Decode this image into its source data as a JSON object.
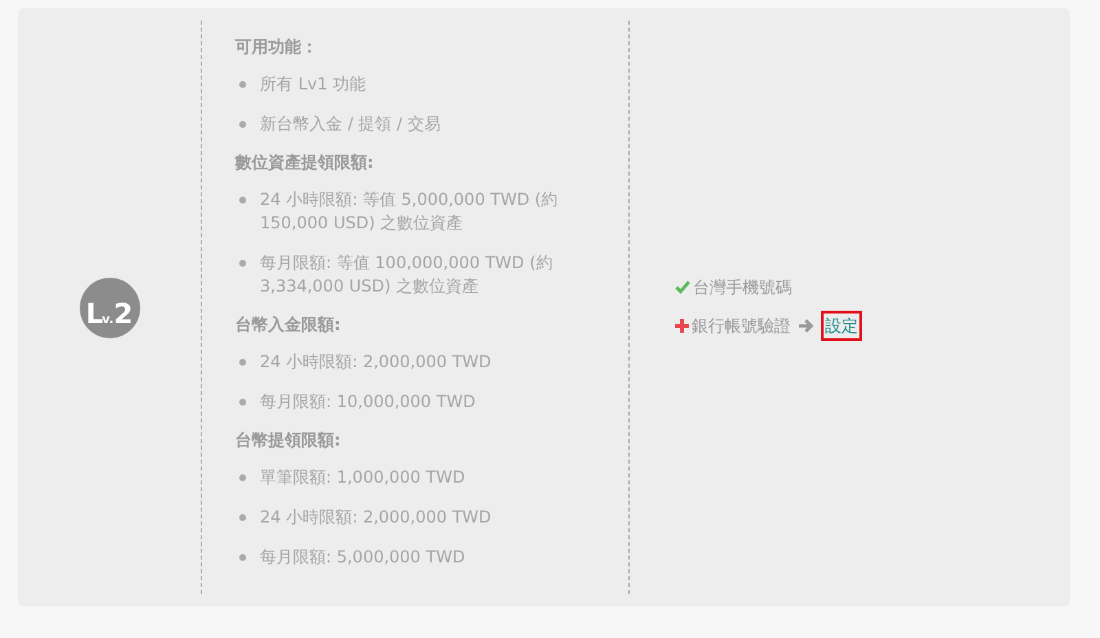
{
  "level_badge": {
    "letter": "L",
    "sub": "v.",
    "number": "2"
  },
  "sections": [
    {
      "heading": "可用功能：",
      "items": [
        "所有 Lv1 功能",
        "新台幣入金 / 提領 / 交易"
      ]
    },
    {
      "heading": "數位資產提領限額:",
      "items": [
        "24 小時限額: 等值 5,000,000 TWD (約 150,000 USD) 之數位資產",
        "每月限額: 等值 100,000,000 TWD (約 3,334,000 USD) 之數位資產"
      ]
    },
    {
      "heading": "台幣入金限額:",
      "items": [
        "24 小時限額: 2,000,000 TWD",
        "每月限額: 10,000,000 TWD"
      ]
    },
    {
      "heading": "台幣提領限額:",
      "items": [
        "單筆限額: 1,000,000 TWD",
        "24 小時限額: 2,000,000 TWD",
        "每月限額: 5,000,000 TWD"
      ]
    }
  ],
  "requirements": [
    {
      "label": "台灣手機號碼",
      "verified": true
    },
    {
      "label": "銀行帳號驗證",
      "verified": false,
      "action": {
        "label": "設定",
        "highlighted": true
      }
    }
  ]
}
